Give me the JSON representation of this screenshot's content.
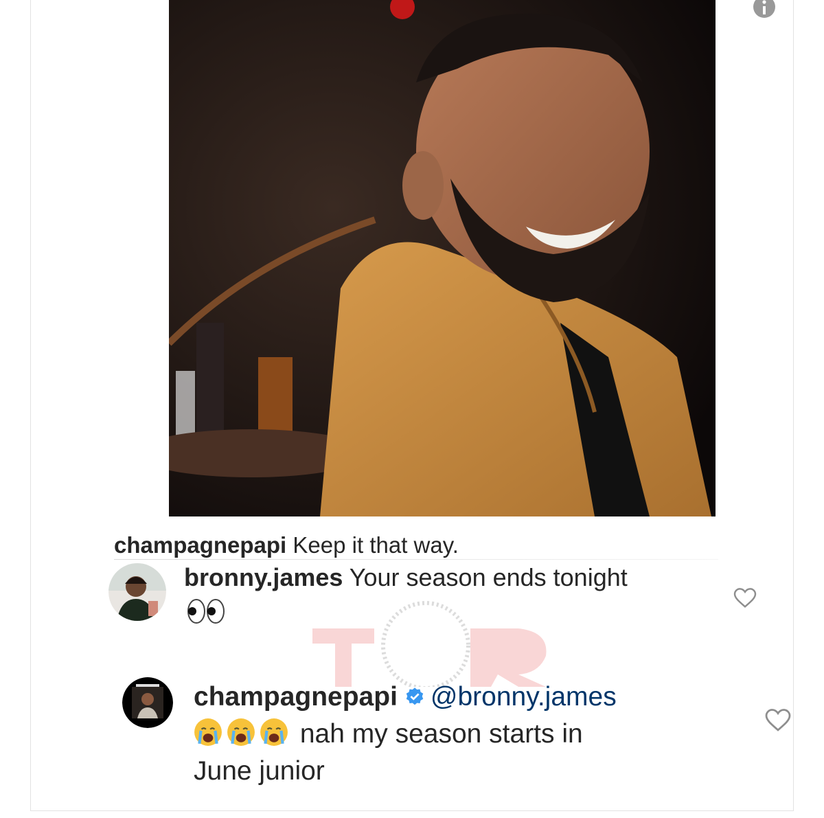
{
  "post": {
    "image": {
      "description": "photo"
    },
    "caption": {
      "username": "champagnepapi",
      "text": "Keep it that way."
    }
  },
  "comments": [
    {
      "username": "bronny.james",
      "text": "Your season ends tonight",
      "emojis": "👀"
    },
    {
      "username": "champagnepapi",
      "verified": true,
      "mention": "@bronny.james",
      "emojis": "😭😭😭",
      "text_line1": "nah my season starts in",
      "text_line2": "June junior"
    }
  ],
  "icons": {
    "info": "info-icon",
    "like": "heart-outline-icon",
    "verified": "verified-badge-icon"
  },
  "colors": {
    "text": "#262626",
    "mention": "#003569",
    "verified": "#3897f0",
    "border": "#e2e2e2"
  }
}
